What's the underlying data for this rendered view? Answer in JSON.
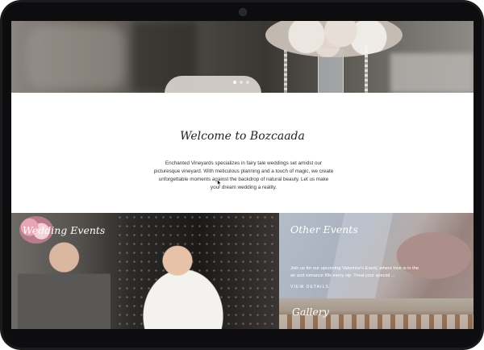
{
  "hero": {
    "slider_dots": 3,
    "active_dot": 1
  },
  "welcome": {
    "title": "Welcome to Bozcaada",
    "text": "Enchanted Vineyards specializes in fairy tale weddings set amidst our picturesque vineyard. With meticulous planning and a touch of magic, we create unforgettable moments against the backdrop of natural beauty.  Let us make your dream wedding a reality."
  },
  "tiles": {
    "wedding": {
      "title": "Wedding Events"
    },
    "other": {
      "title": "Other Events",
      "text": "Join us for our upcoming Valentine's Event, where love is in the air and romance fills every sip. Treat your special ...",
      "link": "VIEW DETAILS"
    },
    "gallery": {
      "title": "Gallery"
    }
  },
  "colors": {
    "device_frame": "#1b1b1d",
    "page_background": "#ffffff",
    "heading_text": "#222222",
    "tile_text": "#ffffff"
  }
}
